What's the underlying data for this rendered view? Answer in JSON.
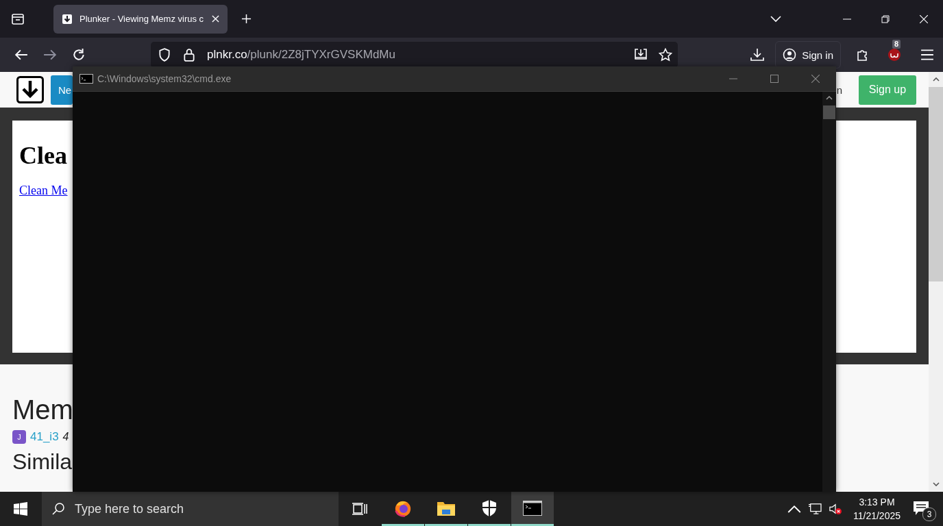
{
  "browser": {
    "tabs": [
      {
        "title": "Plunker - Viewing Memz virus c",
        "selected": true
      }
    ],
    "address": {
      "domain": "plnkr.co",
      "path": "/plunk/2Z8jTYXrGVSKMdMu"
    },
    "account_button": "Sign in",
    "extension_badge": "8"
  },
  "page": {
    "header": {
      "new_button": "Ne",
      "cut_text": "n",
      "signup_button": "Sign up"
    },
    "preview": {
      "heading": "Clea",
      "link": "Clean Me"
    },
    "title": "Mem",
    "author": {
      "avatar": "J",
      "name": "41_i3",
      "meta": "4"
    },
    "section_heading": "Simila"
  },
  "console_window": {
    "title": "C:\\Windows\\system32\\cmd.exe"
  },
  "taskbar": {
    "search_placeholder": "Type here to search",
    "apps": [
      {
        "kind": "firefox",
        "running": true,
        "selected": false
      },
      {
        "kind": "explorer",
        "running": true,
        "selected": false
      },
      {
        "kind": "security",
        "running": true,
        "selected": false
      },
      {
        "kind": "console",
        "running": true,
        "selected": true
      }
    ],
    "time": "3:13 PM",
    "date": "11/21/2025",
    "notifications": "3"
  }
}
